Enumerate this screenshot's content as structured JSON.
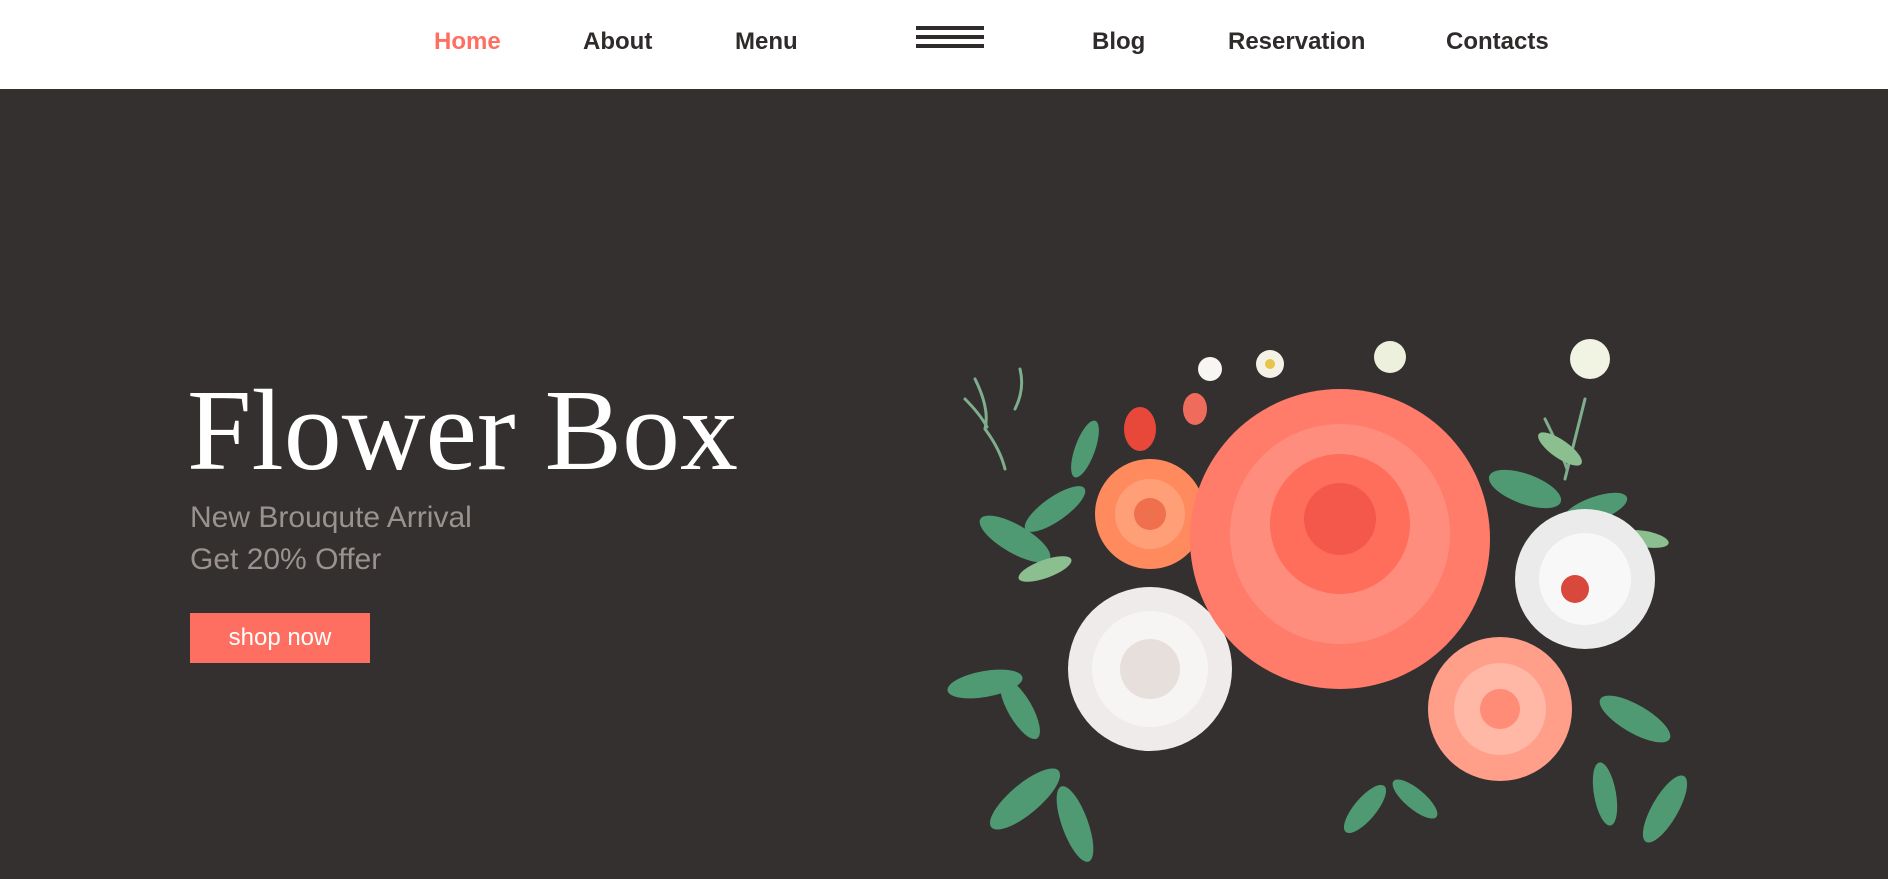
{
  "nav": {
    "items": [
      {
        "label": "Home",
        "active": true
      },
      {
        "label": "About"
      },
      {
        "label": "Menu"
      },
      {
        "label": "Blog"
      },
      {
        "label": "Reservation"
      },
      {
        "label": "Contacts"
      }
    ],
    "menu_icon": "hamburger-icon"
  },
  "hero": {
    "title": "Flower Box",
    "subtitle_line1": "New Brouqute Arrival",
    "subtitle_line2": "Get 20% Offer",
    "cta_label": "shop now",
    "image": "flower-bouquet-illustration"
  },
  "colors": {
    "accent": "#ff6f61",
    "nav_text": "#2f2b2b",
    "hero_bg": "#343030",
    "hero_title": "#ffffff",
    "hero_subtitle": "#9a928e",
    "header_bg": "#ffffff"
  }
}
